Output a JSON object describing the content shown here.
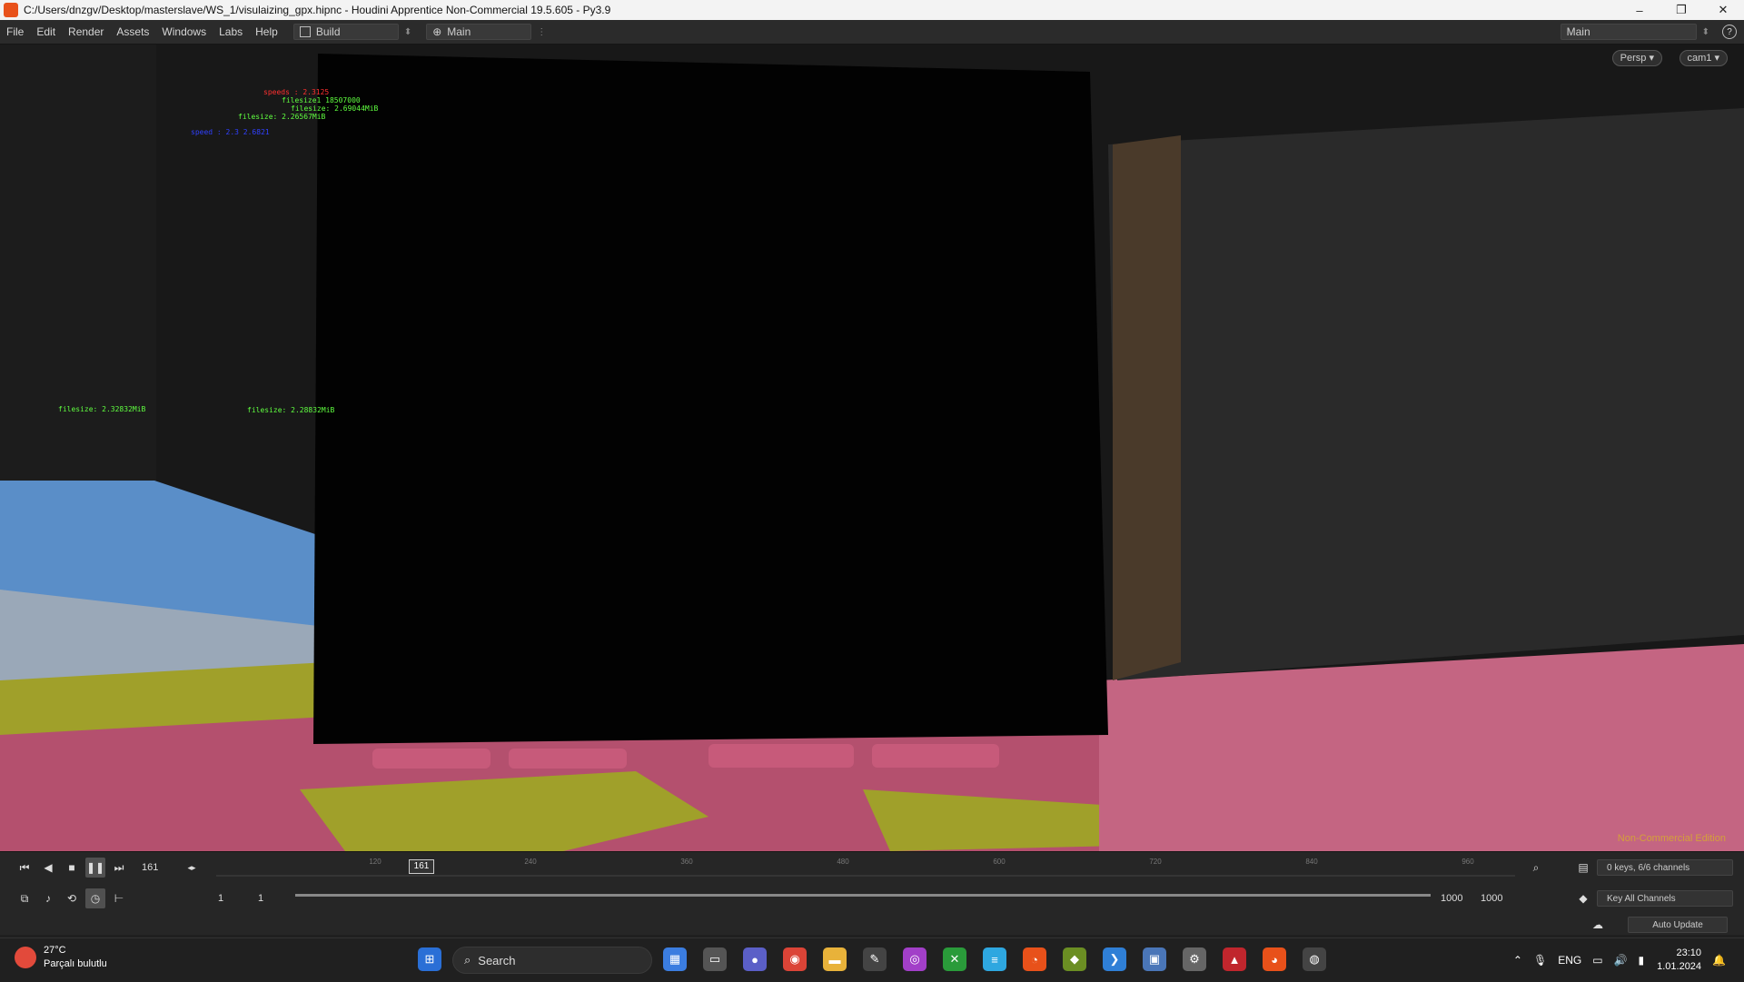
{
  "window": {
    "title": "C:/Users/dnzgv/Desktop/masterslave/WS_1/visulaizing_gpx.hipnc - Houdini Apprentice Non-Commercial 19.5.605 - Py3.9",
    "minimize_glyph": "–",
    "maximize_glyph": "❐",
    "close_glyph": "✕"
  },
  "menu": {
    "items": [
      "File",
      "Edit",
      "Render",
      "Assets",
      "Windows",
      "Labs",
      "Help"
    ],
    "desktop": "Build",
    "network": "Main",
    "right_desktop": "Main",
    "help_glyph": "?"
  },
  "viewport": {
    "persp": "Persp ▾",
    "cam": "cam1 ▾",
    "watermark": "Non-Commercial Edition",
    "overlays": [
      {
        "text": "speeds : 2.3125",
        "color": "red"
      },
      {
        "text": "filesize1 18507000",
        "color": "green"
      },
      {
        "text": "filesize: 2.69044MiB",
        "color": "green"
      },
      {
        "text": "filesize: 2.26567MiB",
        "color": "green"
      },
      {
        "text": "speed : 2.3 2.6821",
        "color": "blue"
      },
      {
        "text": "filesize: 2.32832MiB",
        "color": "green"
      },
      {
        "text": "filesize: 2.28832MiB",
        "color": "green"
      }
    ]
  },
  "timeline": {
    "current_frame": "161",
    "marker": "161",
    "tick_labels": [
      "120",
      "240",
      "360",
      "480",
      "600",
      "720",
      "840",
      "960"
    ],
    "range_start": "1",
    "range_start2": "1",
    "range_end": "1000",
    "range_end2": "1000",
    "keys_info": "0 keys, 6/6 channels",
    "key_all": "Key All Channels",
    "auto_update": "Auto Update"
  },
  "taskbar": {
    "temperature": "27°C",
    "weather_desc": "Parçalı bulutlu",
    "search": "Search",
    "lang": "ENG",
    "time": "23:10",
    "date": "1.01.2024"
  },
  "colors": {
    "pink": "#b4506e",
    "olive": "#a0a02a",
    "sky": "#5a8ec8",
    "accent_orange": "#e8511a"
  }
}
